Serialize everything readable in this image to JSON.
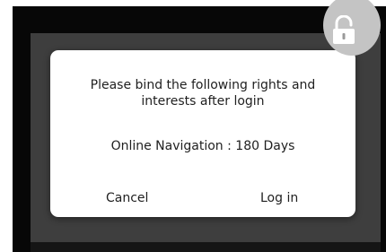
{
  "dialog": {
    "message_line1": "Please bind the following rights and",
    "message_line2": "interests after login",
    "benefit": "Online Navigation : 180 Days",
    "cancel_label": "Cancel",
    "login_label": "Log in"
  },
  "icons": {
    "lock": "unlock-icon"
  },
  "colors": {
    "backdrop": "#070707",
    "panel": "#3e3e3e",
    "dialog_bg": "#ffffff",
    "text": "#1f1f1f",
    "badge": "#c4c4c4"
  }
}
